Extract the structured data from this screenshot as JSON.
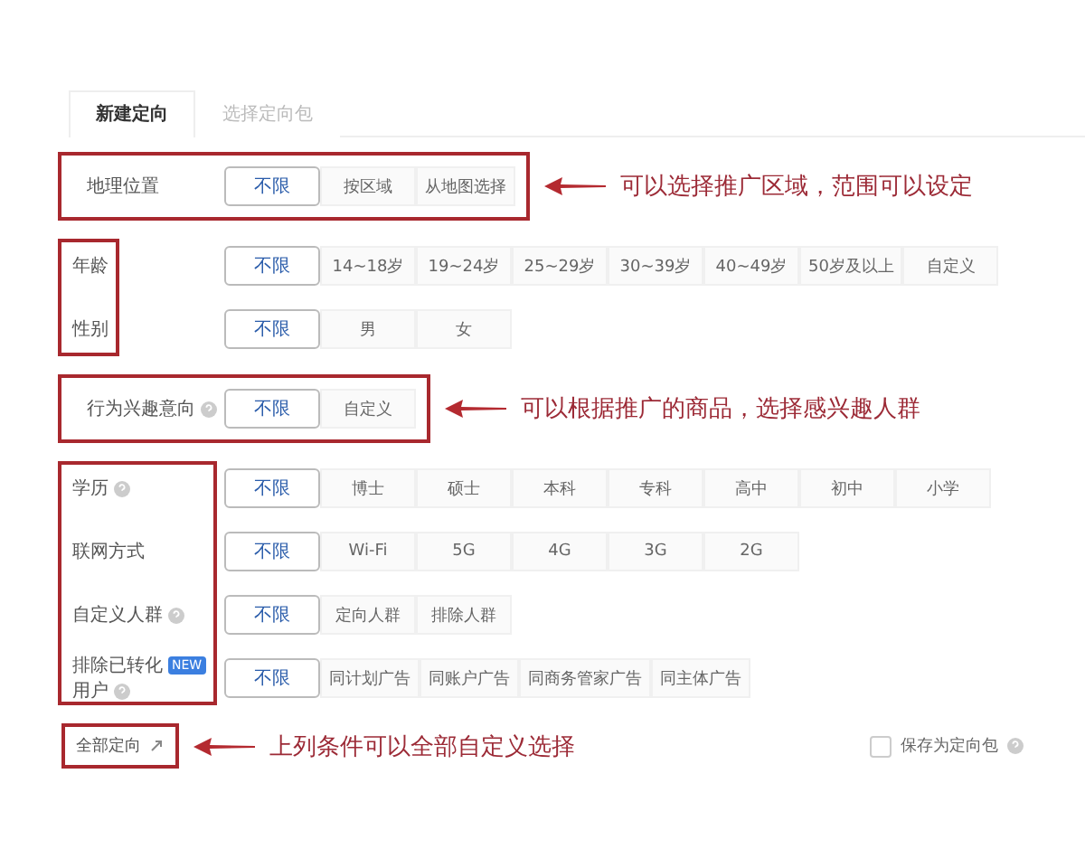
{
  "tabs": [
    {
      "label": "新建定向",
      "selected": true
    },
    {
      "label": "选择定向包",
      "selected": false
    }
  ],
  "groups": [
    {
      "kind": "framed",
      "annotation": "可以选择推广区域，范围可以设定",
      "rows": [
        {
          "label": "地理位置",
          "options": [
            {
              "label": "不限",
              "selected": true
            },
            {
              "label": "按区域",
              "selected": false
            },
            {
              "label": "从地图选择",
              "selected": false
            }
          ]
        }
      ]
    },
    {
      "kind": "label-framed",
      "rows": [
        {
          "label": "年龄",
          "options": [
            {
              "label": "不限",
              "selected": true
            },
            {
              "label": "14~18岁",
              "selected": false
            },
            {
              "label": "19~24岁",
              "selected": false
            },
            {
              "label": "25~29岁",
              "selected": false
            },
            {
              "label": "30~39岁",
              "selected": false
            },
            {
              "label": "40~49岁",
              "selected": false
            },
            {
              "label": "50岁及以上",
              "selected": false
            },
            {
              "label": "自定义",
              "selected": false
            }
          ]
        },
        {
          "label": "性别",
          "options": [
            {
              "label": "不限",
              "selected": true
            },
            {
              "label": "男",
              "selected": false
            },
            {
              "label": "女",
              "selected": false
            }
          ]
        }
      ]
    },
    {
      "kind": "framed",
      "annotation": "可以根据推广的商品，选择感兴趣人群",
      "rows": [
        {
          "label": "行为兴趣意向",
          "help": true,
          "options": [
            {
              "label": "不限",
              "selected": true
            },
            {
              "label": "自定义",
              "selected": false
            }
          ]
        }
      ]
    },
    {
      "kind": "label-framed",
      "rows": [
        {
          "label": "学历",
          "help": true,
          "options": [
            {
              "label": "不限",
              "selected": true
            },
            {
              "label": "博士",
              "selected": false
            },
            {
              "label": "硕士",
              "selected": false
            },
            {
              "label": "本科",
              "selected": false
            },
            {
              "label": "专科",
              "selected": false
            },
            {
              "label": "高中",
              "selected": false
            },
            {
              "label": "初中",
              "selected": false
            },
            {
              "label": "小学",
              "selected": false
            }
          ]
        },
        {
          "label": "联网方式",
          "options": [
            {
              "label": "不限",
              "selected": true
            },
            {
              "label": "Wi-Fi",
              "selected": false
            },
            {
              "label": "5G",
              "selected": false
            },
            {
              "label": "4G",
              "selected": false
            },
            {
              "label": "3G",
              "selected": false
            },
            {
              "label": "2G",
              "selected": false
            }
          ]
        },
        {
          "label": "自定义人群",
          "help": true,
          "options": [
            {
              "label": "不限",
              "selected": true
            },
            {
              "label": "定向人群",
              "selected": false
            },
            {
              "label": "排除人群",
              "selected": false
            }
          ]
        },
        {
          "label": "排除已转化",
          "badge": "NEW",
          "label_2": "用户",
          "help": true,
          "options": [
            {
              "label": "不限",
              "selected": true
            },
            {
              "label": "同计划广告",
              "selected": false
            },
            {
              "label": "同账户广告",
              "selected": false
            },
            {
              "label": "同商务管家广告",
              "selected": false
            },
            {
              "label": "同主体广告",
              "selected": false
            }
          ]
        }
      ]
    }
  ],
  "footer": {
    "link": "全部定向",
    "annotation": "上列条件可以全部自定义选择",
    "save": {
      "label": "保存为定向包",
      "checked": false
    }
  }
}
